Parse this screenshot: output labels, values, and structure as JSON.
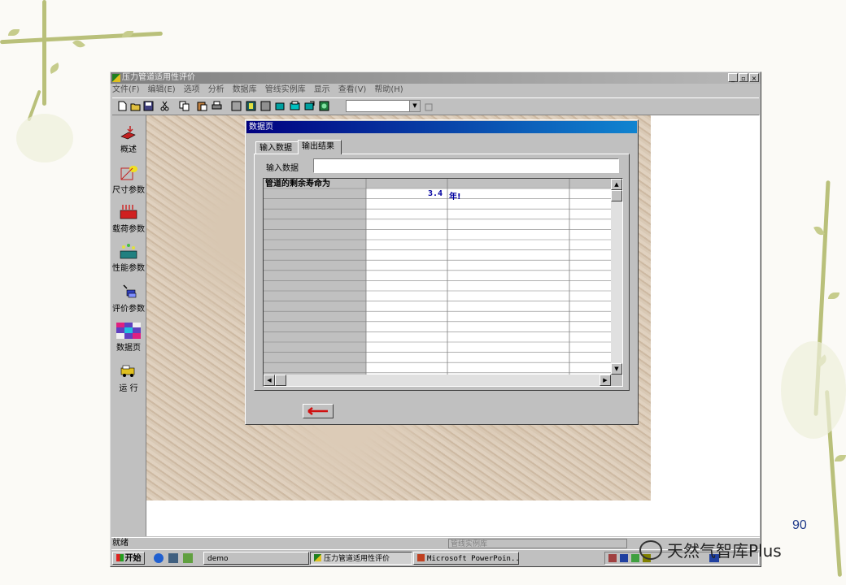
{
  "app": {
    "title": "压力管道适用性评价",
    "window_buttons": [
      "_",
      "▫",
      "×"
    ],
    "menu": [
      "文件(F)",
      "编辑(E)",
      "选项",
      "分析",
      "数据库",
      "管线实例库",
      "显示",
      "查看(V)",
      "帮助(H)"
    ]
  },
  "sidebar": {
    "items": [
      {
        "label": "概述",
        "icon": "overview-icon"
      },
      {
        "label": "尺寸参数",
        "icon": "dimension-icon"
      },
      {
        "label": "载荷参数",
        "icon": "load-icon"
      },
      {
        "label": "性能参数",
        "icon": "performance-icon"
      },
      {
        "label": "评价参数",
        "icon": "evaluation-icon"
      },
      {
        "label": "数据页",
        "icon": "datasheet-icon"
      },
      {
        "label": "运  行",
        "icon": "run-icon"
      }
    ]
  },
  "dialog": {
    "title": "数据页",
    "tabs": [
      "输入数据",
      "输出结果"
    ],
    "active_tab": 1,
    "field_label": "输入数据",
    "field_value": "",
    "grid": {
      "header": "管道的剩余寿命为",
      "value": "3.4",
      "unit": "年!"
    }
  },
  "statusbar": {
    "left": "就绪",
    "panel": "管线实例库"
  },
  "taskbar": {
    "start": "开始",
    "buttons": [
      "demo",
      "压力管道适用性评价",
      "Microsoft PowerPoin..."
    ],
    "active_index": 1
  },
  "slide": {
    "page_number": "90",
    "watermark": "天然气智库Plus"
  },
  "colors": {
    "dialog_title": "#000080",
    "accent_text": "#0000a0",
    "page_number": "#1f3a8a"
  }
}
